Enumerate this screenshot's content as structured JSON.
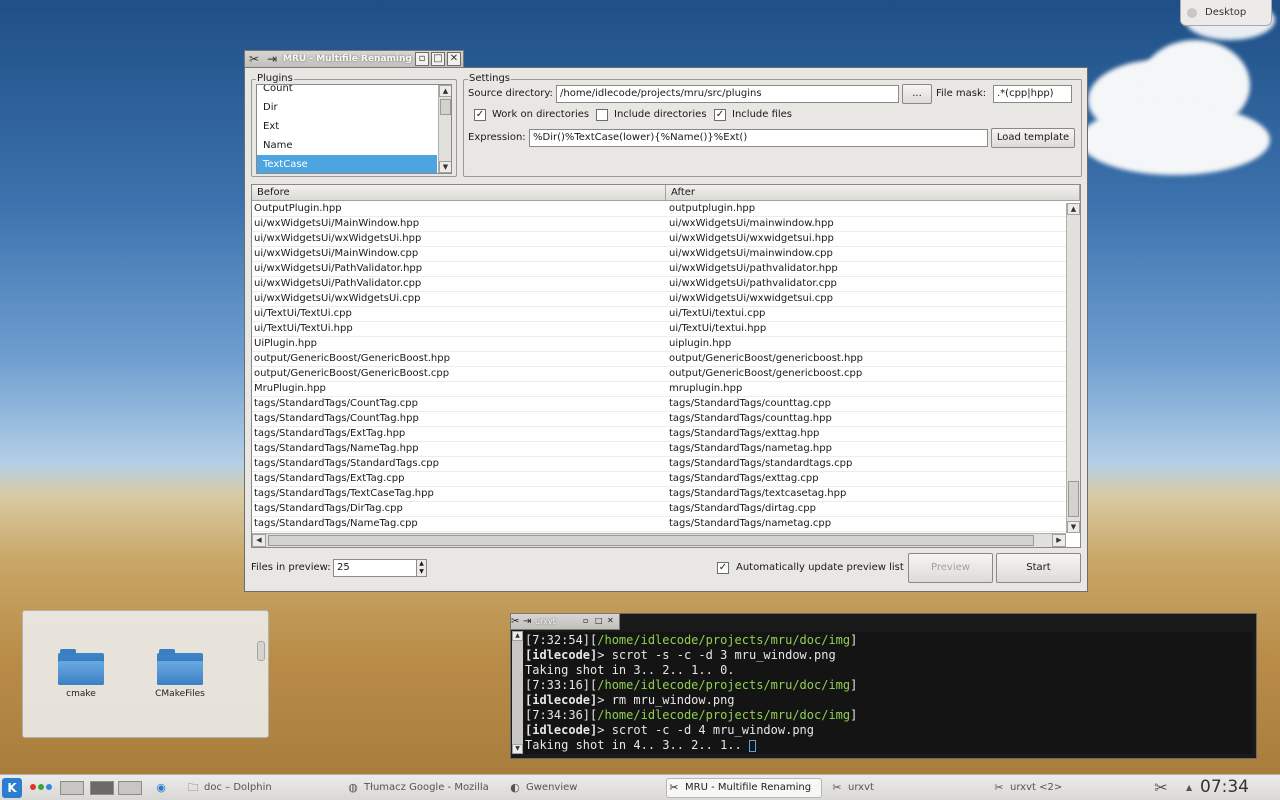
{
  "desktop": {
    "button_label": "Desktop"
  },
  "mru_window": {
    "title": "MRU - Multifile Renaming Utility",
    "plugins": {
      "group_label": "Plugins",
      "items": [
        "Count",
        "Dir",
        "Ext",
        "Name",
        "TextCase"
      ],
      "selected": "TextCase"
    },
    "settings": {
      "group_label": "Settings",
      "source_dir_label": "Source directory:",
      "source_dir_value": "/home/idlecode/projects/mru/src/plugins",
      "browse_label": "...",
      "file_mask_label": "File mask:",
      "file_mask_value": ".*(cpp|hpp)",
      "work_on_dirs_label": "Work on directories",
      "include_dirs_label": "Include directories",
      "include_files_label": "Include files",
      "expression_label": "Expression:",
      "expression_value": "%Dir()%TextCase(lower){%Name()}%Ext()",
      "load_template_label": "Load template"
    },
    "table": {
      "col_before": "Before",
      "col_after": "After",
      "rows": [
        {
          "before": "OutputPlugin.hpp",
          "after": "outputplugin.hpp"
        },
        {
          "before": "ui/wxWidgetsUi/MainWindow.hpp",
          "after": "ui/wxWidgetsUi/mainwindow.hpp"
        },
        {
          "before": "ui/wxWidgetsUi/wxWidgetsUi.hpp",
          "after": "ui/wxWidgetsUi/wxwidgetsui.hpp"
        },
        {
          "before": "ui/wxWidgetsUi/MainWindow.cpp",
          "after": "ui/wxWidgetsUi/mainwindow.cpp"
        },
        {
          "before": "ui/wxWidgetsUi/PathValidator.hpp",
          "after": "ui/wxWidgetsUi/pathvalidator.hpp"
        },
        {
          "before": "ui/wxWidgetsUi/PathValidator.cpp",
          "after": "ui/wxWidgetsUi/pathvalidator.cpp"
        },
        {
          "before": "ui/wxWidgetsUi/wxWidgetsUi.cpp",
          "after": "ui/wxWidgetsUi/wxwidgetsui.cpp"
        },
        {
          "before": "ui/TextUi/TextUi.cpp",
          "after": "ui/TextUi/textui.cpp"
        },
        {
          "before": "ui/TextUi/TextUi.hpp",
          "after": "ui/TextUi/textui.hpp"
        },
        {
          "before": "UiPlugin.hpp",
          "after": "uiplugin.hpp"
        },
        {
          "before": "output/GenericBoost/GenericBoost.hpp",
          "after": "output/GenericBoost/genericboost.hpp"
        },
        {
          "before": "output/GenericBoost/GenericBoost.cpp",
          "after": "output/GenericBoost/genericboost.cpp"
        },
        {
          "before": "MruPlugin.hpp",
          "after": "mruplugin.hpp"
        },
        {
          "before": "tags/StandardTags/CountTag.cpp",
          "after": "tags/StandardTags/counttag.cpp"
        },
        {
          "before": "tags/StandardTags/CountTag.hpp",
          "after": "tags/StandardTags/counttag.hpp"
        },
        {
          "before": "tags/StandardTags/ExtTag.hpp",
          "after": "tags/StandardTags/exttag.hpp"
        },
        {
          "before": "tags/StandardTags/NameTag.hpp",
          "after": "tags/StandardTags/nametag.hpp"
        },
        {
          "before": "tags/StandardTags/StandardTags.cpp",
          "after": "tags/StandardTags/standardtags.cpp"
        },
        {
          "before": "tags/StandardTags/ExtTag.cpp",
          "after": "tags/StandardTags/exttag.cpp"
        },
        {
          "before": "tags/StandardTags/TextCaseTag.hpp",
          "after": "tags/StandardTags/textcasetag.hpp"
        },
        {
          "before": "tags/StandardTags/DirTag.cpp",
          "after": "tags/StandardTags/dirtag.cpp"
        },
        {
          "before": "tags/StandardTags/NameTag.cpp",
          "after": "tags/StandardTags/nametag.cpp"
        }
      ]
    },
    "bottom": {
      "files_in_preview_label": "Files in preview:",
      "files_in_preview_value": "25",
      "auto_update_label": "Automatically update preview list",
      "preview_label": "Preview",
      "start_label": "Start"
    }
  },
  "folder_panel": {
    "folders": [
      "cmake",
      "CMakeFiles"
    ]
  },
  "terminal": {
    "title": "urxvt",
    "lines": [
      {
        "prompt": "[7:32:54][",
        "path": "/home/idlecode/projects/mru/doc/img",
        "end": "]"
      },
      {
        "user": "[idlecode]",
        "cmd": "> scrot -s -c -d 3 mru_window.png"
      },
      {
        "text": "Taking shot in 3.. 2.. 1.. 0."
      },
      {
        "prompt": "[7:33:16][",
        "path": "/home/idlecode/projects/mru/doc/img",
        "end": "]"
      },
      {
        "user": "[idlecode]",
        "cmd": "> rm mru_window.png"
      },
      {
        "prompt": "[7:34:36][",
        "path": "/home/idlecode/projects/mru/doc/img",
        "end": "]"
      },
      {
        "user": "[idlecode]",
        "cmd": "> scrot -c -d 4 mru_window.png"
      },
      {
        "text": "Taking shot in 4.. 3.. 2.. 1.. "
      }
    ]
  },
  "taskbar": {
    "items": [
      {
        "label": "doc – Dolphin",
        "icon": "dolphin-icon"
      },
      {
        "label": "Tłumacz Google - Mozilla",
        "icon": "firefox-icon"
      },
      {
        "label": "Gwenview",
        "icon": "gwenview-icon"
      },
      {
        "label": "MRU - Multifile Renaming",
        "icon": "mru-app-icon"
      },
      {
        "label": "urxvt",
        "icon": "terminal-icon"
      },
      {
        "label": "urxvt <2>",
        "icon": "terminal-icon"
      }
    ],
    "clock": "07:34"
  }
}
